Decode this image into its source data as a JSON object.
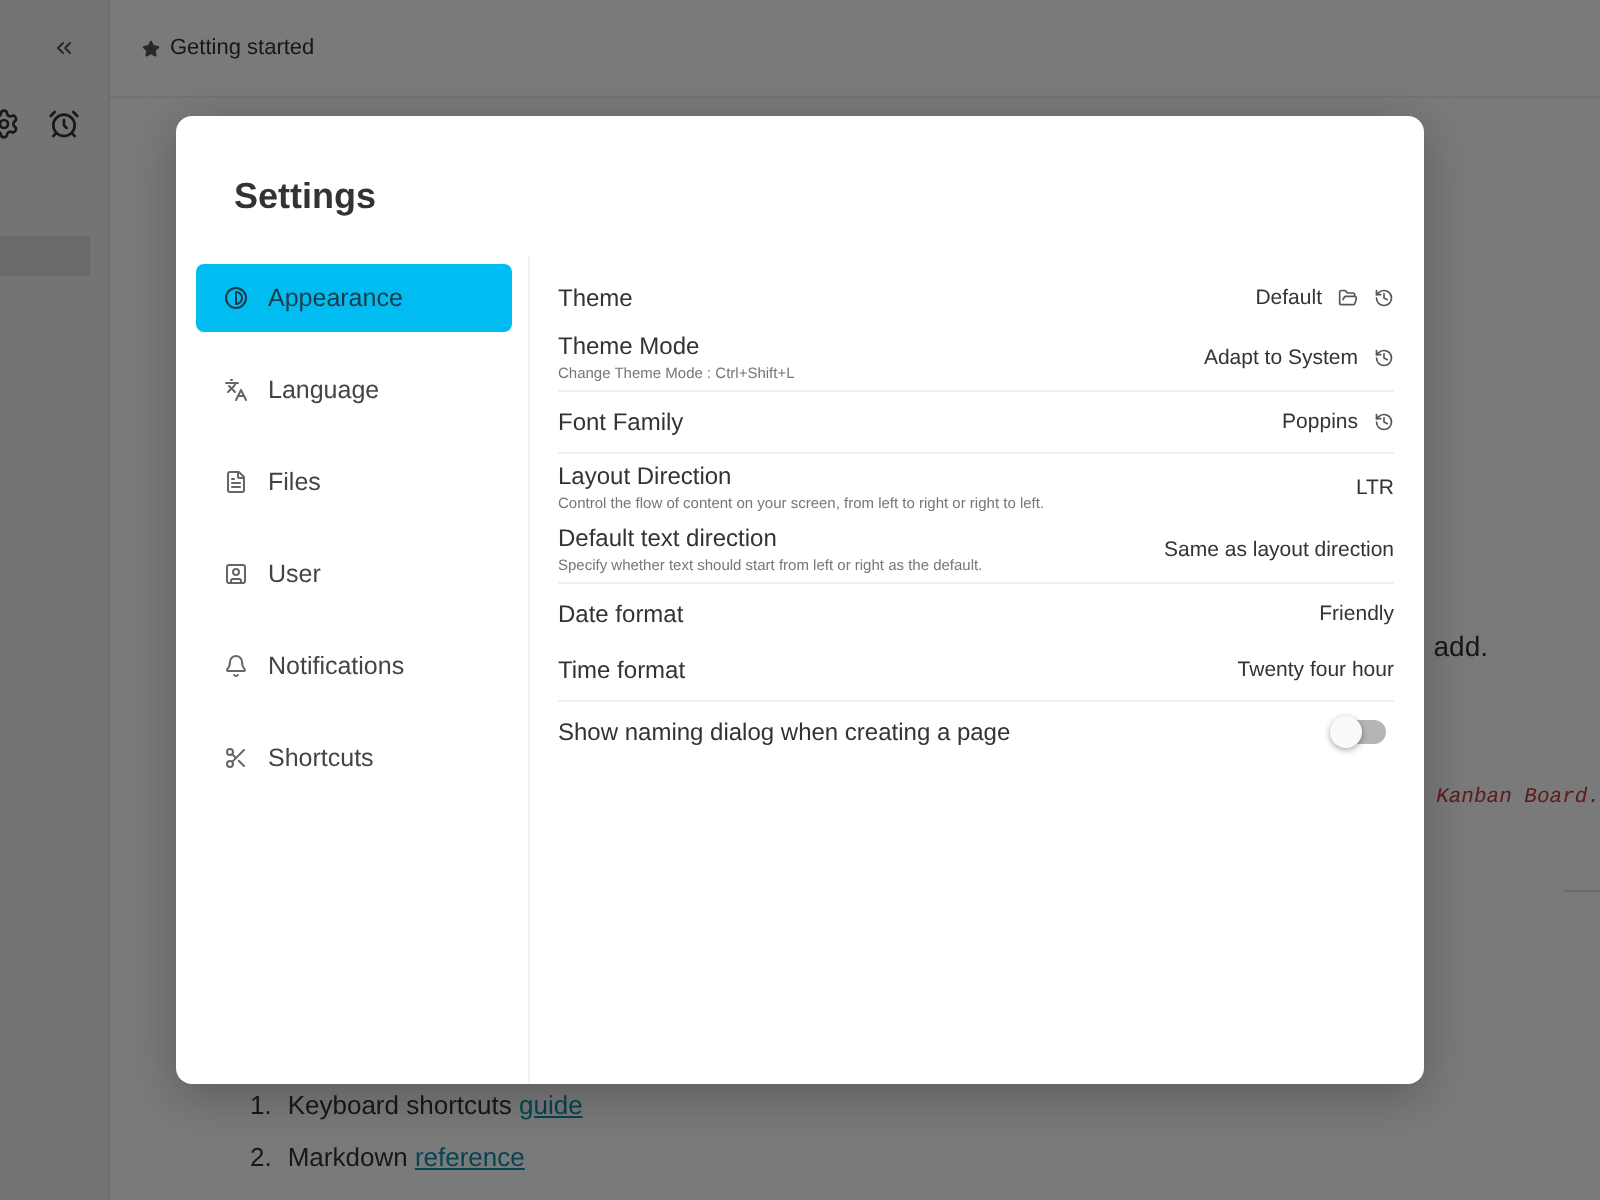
{
  "app": {
    "breadcrumb": "Getting started",
    "text_fragment": "add.",
    "code_fragment": "Kanban Board.",
    "list": [
      {
        "number": "1.",
        "text": "Keyboard shortcuts",
        "link": "guide"
      },
      {
        "number": "2.",
        "text": "Markdown",
        "link": "reference"
      }
    ]
  },
  "settings": {
    "title": "Settings",
    "nav": [
      {
        "label": "Appearance",
        "selected": true
      },
      {
        "label": "Language",
        "selected": false
      },
      {
        "label": "Files",
        "selected": false
      },
      {
        "label": "User",
        "selected": false
      },
      {
        "label": "Notifications",
        "selected": false
      },
      {
        "label": "Shortcuts",
        "selected": false
      }
    ],
    "groups": [
      [
        {
          "kind": "value",
          "label": "Theme",
          "value": "Default",
          "folder": true,
          "reset": true
        },
        {
          "kind": "value",
          "label": "Theme Mode",
          "description": "Change Theme Mode : Ctrl+Shift+L",
          "value": "Adapt to System",
          "reset": true
        }
      ],
      [
        {
          "kind": "value",
          "label": "Font Family",
          "value": "Poppins",
          "reset": true
        }
      ],
      [
        {
          "kind": "value",
          "label": "Layout Direction",
          "description": "Control the flow of content on your screen, from left to right or right to left.",
          "value": "LTR"
        },
        {
          "kind": "value",
          "label": "Default text direction",
          "description": "Specify whether text should start from left or right as the default.",
          "value": "Same as layout direction"
        }
      ],
      [
        {
          "kind": "value",
          "label": "Date format",
          "value": "Friendly"
        },
        {
          "kind": "value",
          "label": "Time format",
          "value": "Twenty four hour"
        }
      ],
      [
        {
          "kind": "toggle",
          "label": "Show naming dialog when creating a page",
          "on": false
        }
      ]
    ]
  }
}
